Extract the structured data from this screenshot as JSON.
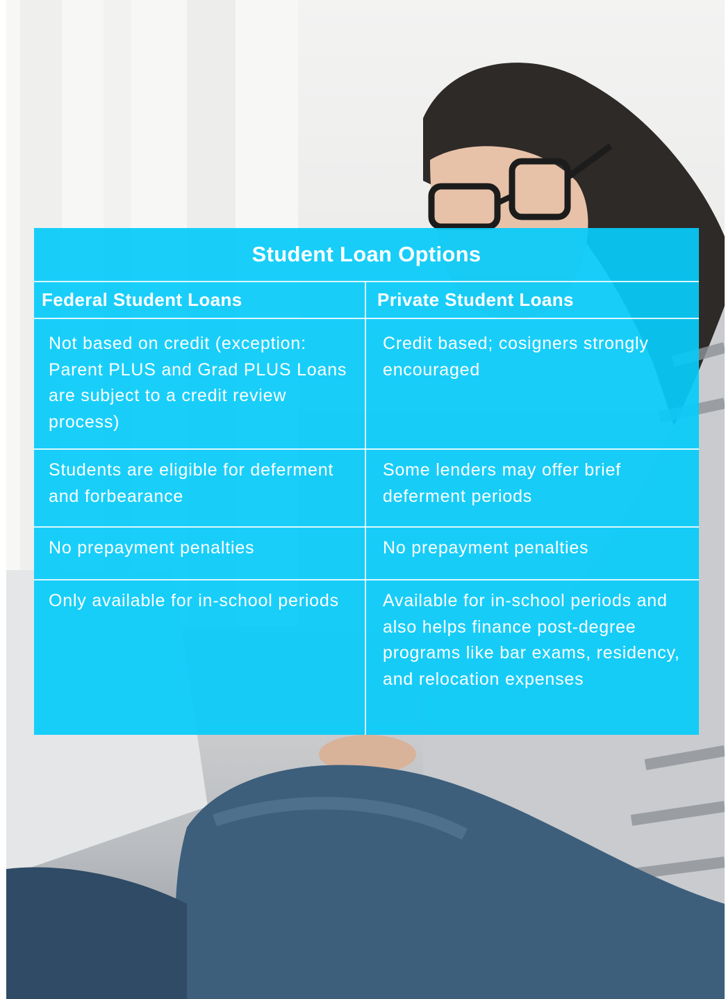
{
  "background": {
    "description_icon": "woman-with-laptop-photo"
  },
  "table": {
    "title": "Student Loan Options",
    "headers": [
      "Federal Student Loans",
      "Private Student Loans"
    ],
    "rows": [
      {
        "federal": "Not based on credit (exception: Parent PLUS and Grad PLUS Loans are subject to a credit review process)",
        "private": "Credit based; cosigners strongly encouraged"
      },
      {
        "federal": "Students are eligible for deferment and forbearance",
        "private": "Some lenders may offer brief deferment periods"
      },
      {
        "federal": "No prepayment penalties",
        "private": "No prepayment penalties"
      },
      {
        "federal": "Only available for in-school periods",
        "private": "Available for in-school periods and also helps finance post-degree programs like bar exams, residency, and relocation expenses"
      }
    ],
    "colors": {
      "panel": "#08cbfa",
      "text": "#ffffff"
    }
  }
}
